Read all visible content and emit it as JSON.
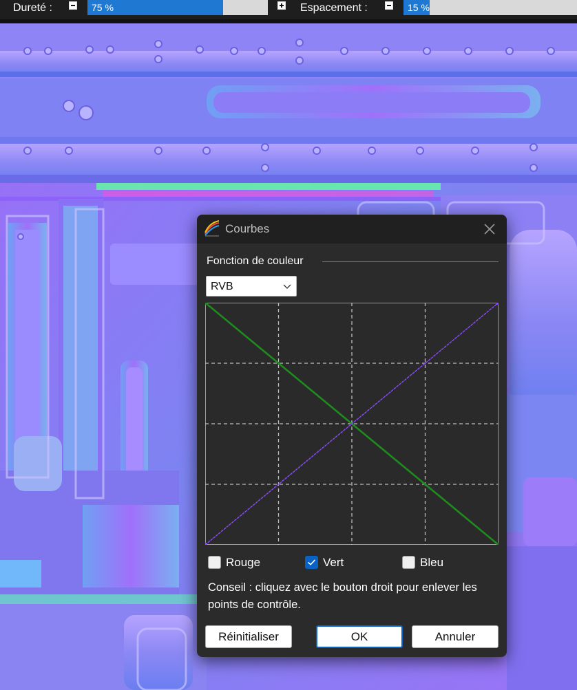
{
  "toolbar": {
    "hardness_label": "Dureté :",
    "hardness_value": "75 %",
    "hardness_fraction": 0.75,
    "spacing_label": "Espacement :",
    "spacing_value": "15 %",
    "spacing_fraction": 0.15
  },
  "dialog": {
    "title": "Courbes",
    "section_label": "Fonction de couleur",
    "channel_select": {
      "selected": "RVB"
    },
    "curves": {
      "grid_divisions": 4,
      "rgb_curve": {
        "color": "#8a4bff",
        "points": [
          [
            0,
            0
          ],
          [
            255,
            255
          ]
        ]
      },
      "green_curve": {
        "color": "#1e8c1e",
        "points": [
          [
            0,
            255
          ],
          [
            255,
            0
          ]
        ]
      }
    },
    "checkboxes": [
      {
        "label": "Rouge",
        "checked": false
      },
      {
        "label": "Vert",
        "checked": true
      },
      {
        "label": "Bleu",
        "checked": false
      }
    ],
    "hint": "Conseil : cliquez avec le bouton droit pour enlever les points de contrôle.",
    "buttons": {
      "reset": "Réinitialiser",
      "ok": "OK",
      "cancel": "Annuler"
    }
  },
  "colors": {
    "accent": "#0a63c4",
    "slider_fill": "#1f78d1",
    "graph_bg": "#2a2a2a",
    "canvas_base": "#8a7cf4"
  }
}
